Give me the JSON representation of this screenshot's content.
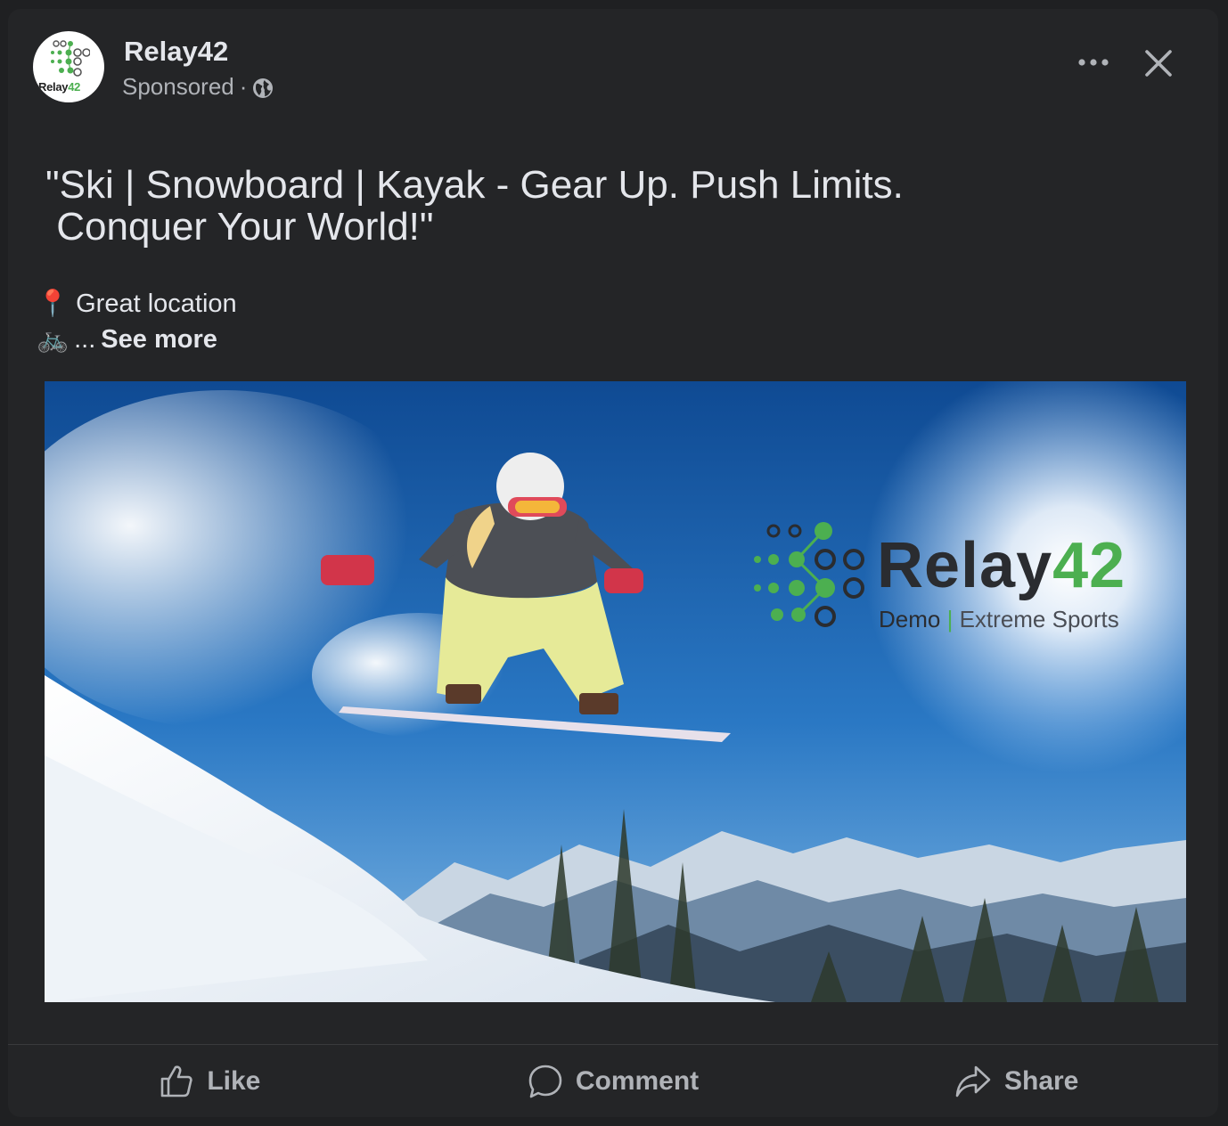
{
  "post": {
    "page_name": "Relay42",
    "sponsored_label": "Sponsored",
    "meta_separator": "·",
    "avatar_text_dark": "Relay",
    "avatar_text_green": "42",
    "headline": "\"Ski | Snowboard | Kayak - Gear Up. Push Limits.\n Conquer Your World!\"",
    "line1_emoji": "📍",
    "line1_text": "Great location",
    "line2_emoji": "🚲",
    "line2_ellipsis": "...",
    "see_more": "See more"
  },
  "image": {
    "brand_dark": "Relay",
    "brand_green": "42",
    "brand_sub_dark": "Demo",
    "brand_sub_sep": "|",
    "brand_sub_rest": "Extreme Sports"
  },
  "actions": [
    {
      "label": "Like",
      "icon": "thumbs-up-icon"
    },
    {
      "label": "Comment",
      "icon": "comment-bubble-icon"
    },
    {
      "label": "Share",
      "icon": "share-arrow-icon"
    }
  ],
  "icons": {
    "more": "more-dots-icon",
    "close": "close-icon",
    "globe": "globe-icon"
  },
  "colors": {
    "background": "#242527",
    "text_primary": "#e4e6eb",
    "text_secondary": "#b0b3b8",
    "brand_green": "#4caf50"
  }
}
